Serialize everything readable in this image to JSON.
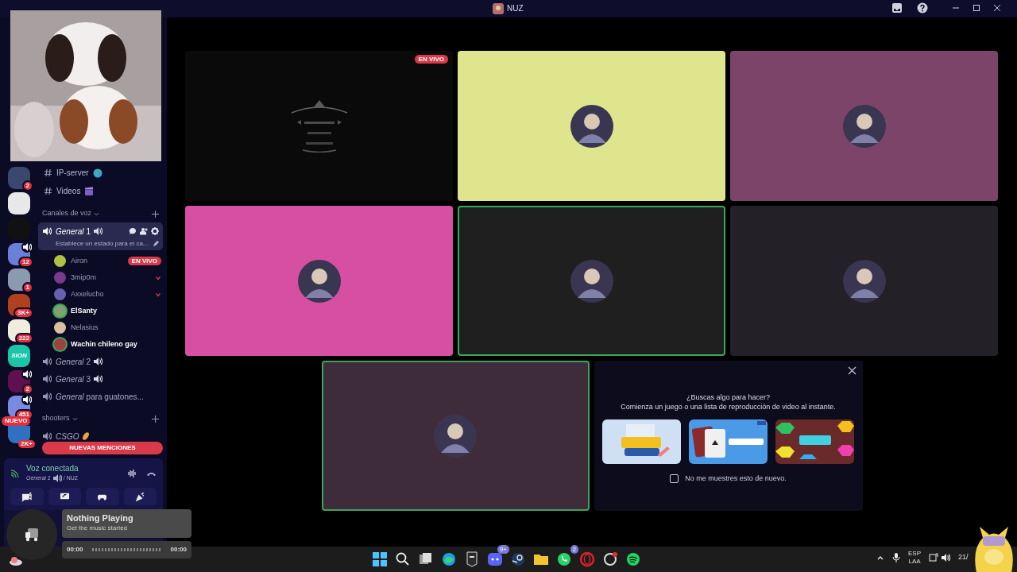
{
  "title_bar": {
    "title": "NUZ"
  },
  "servers": [
    {
      "speaker": false,
      "badge": "2"
    },
    {
      "speaker": false
    },
    {
      "speaker": false
    },
    {
      "speaker": true,
      "badge": "12"
    },
    {
      "speaker": false,
      "badge": "1"
    },
    {
      "speaker": false,
      "badge": "3K+"
    },
    {
      "speaker": false,
      "badge": "222"
    },
    {
      "speaker": false,
      "label": "SION"
    },
    {
      "speaker": true,
      "badge": "2"
    },
    {
      "speaker": true,
      "badge": "451"
    },
    {
      "speaker": false,
      "new_label": "NUEVO",
      "badge": "2K+"
    }
  ],
  "text_channels": [
    {
      "name": "IP-server",
      "kind": "globe"
    },
    {
      "name": "Videos",
      "kind": "clapper"
    }
  ],
  "voice_category": {
    "name": "Canales de voz"
  },
  "voice_channels": [
    {
      "name": "General",
      "suffix": "1",
      "kind": "speaker",
      "selected": true,
      "status": "Establece un estado para el ca...",
      "users": [
        {
          "name": "Airon",
          "live_label": "EN VIVO",
          "chevron": false,
          "speaking": false
        },
        {
          "name": "3mip0m",
          "chevron": true,
          "speaking": false
        },
        {
          "name": "Axxelucho",
          "chevron": true,
          "speaking": false
        },
        {
          "name": "ElSanty",
          "chevron": false,
          "speaking": true
        },
        {
          "name": "Nelasius",
          "chevron": false,
          "speaking": false
        },
        {
          "name": "Wachin chileno gay",
          "chevron": false,
          "speaking": true
        }
      ]
    },
    {
      "name": "General",
      "suffix": "2",
      "kind": "speaker",
      "selected": false
    },
    {
      "name": "General",
      "suffix": "3",
      "kind": "speaker",
      "selected": false
    },
    {
      "name": "General",
      "suffix": "para guatones...",
      "kind": "plain",
      "selected": false
    }
  ],
  "shooters_category": {
    "name": "shooters",
    "channels": [
      {
        "name": "CSGO",
        "kind": "spark",
        "selected": false
      }
    ]
  },
  "mentions_pill": "NUEVAS MENCIONES",
  "voice_panel": {
    "status": "Voz conectada",
    "channel": "General 1",
    "server": "/ NUZ"
  },
  "tiles": [
    {
      "kind": "stream",
      "color": "#0a0a0a",
      "live_label": "EN VIVO",
      "speaking": false
    },
    {
      "kind": "avatar",
      "color": "#dfe58d",
      "speaking": false
    },
    {
      "kind": "avatar",
      "color": "#7b4468",
      "speaking": false
    },
    {
      "kind": "avatar",
      "color": "#d64fa2",
      "speaking": false
    },
    {
      "kind": "avatar",
      "color": "#1f1f1f",
      "speaking": true
    },
    {
      "kind": "avatar",
      "color": "#232027",
      "speaking": false
    },
    {
      "kind": "avatar",
      "color": "#3e2c3b",
      "speaking": true
    }
  ],
  "activity": {
    "title": "¿Buscas algo para hacer?",
    "subtitle": "Comienza un juego o una lista de reproducción de video al instante.",
    "games": [
      {
        "kind": "sudoku"
      },
      {
        "kind": "blackjack"
      },
      {
        "kind": "hexa"
      }
    ],
    "dont_show": {
      "label": "No me muestres esto de nuevo.",
      "checked": false
    }
  },
  "music": {
    "title": "Nothing Playing",
    "subtitle": "Get the music started",
    "elapsed": "00:00",
    "total": "00:00"
  },
  "taskbar": {
    "apps": [
      {
        "kind": "windows"
      },
      {
        "kind": "search"
      },
      {
        "kind": "taskview"
      },
      {
        "kind": "edge"
      },
      {
        "kind": "epic"
      },
      {
        "kind": "discord",
        "badge": "9+"
      },
      {
        "kind": "steam"
      },
      {
        "kind": "files"
      },
      {
        "kind": "whatsapp",
        "badge": "2"
      },
      {
        "kind": "opera"
      },
      {
        "kind": "ring"
      },
      {
        "kind": "spotify"
      }
    ],
    "language": "ESP",
    "region": "LAA",
    "clock": "21/"
  }
}
